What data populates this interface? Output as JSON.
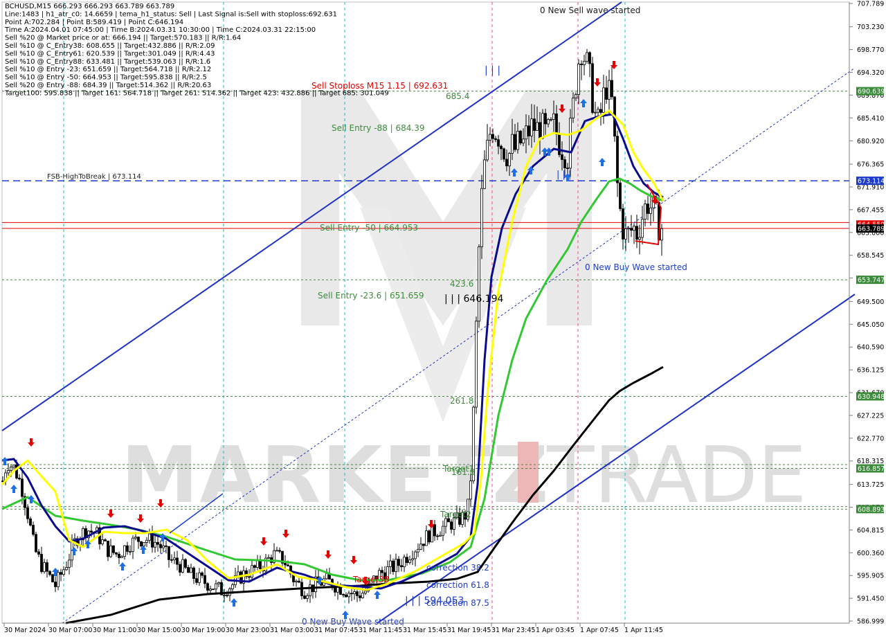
{
  "header": {
    "lines": [
      "BCHUSD,M15  666.293 666.293 663.789 663.789",
      "Line:1483 | h1_atr_c0: 14.6659 | tema_h1_status: Sell | Last Signal is:Sell with stoploss:692.631",
      "Point A:702.284 | Point B:589.419 | Point C:646.194",
      "Time A:2024.04.01 07:45:00 | Time B:2024.03.31 10:30:00 | Time C:2024.03.31 22:15:00",
      "Sell %20 @ Market price or at: 666.194 || Target:570.183 || R/R:1.64",
      "Sell %10 @ C_Entry38: 608.655 || Target:432.886 || R/R:2.09",
      "Sell %10 @ C_Entry61: 620.539 || Target:301.049 || R/R:4.43",
      "Sell %10 @ C_Entry88: 633.481 || Target:539.063 || R/R:1.6",
      "Sell %10 @ Entry -23: 651.659 || Target:564.718 || R/R:2.12",
      "Sell %10 @ Entry -50: 664.953 || Target:595.838 || R/R:2.5",
      "Sell %20 @ Entry -88: 684.39 || Target:514.362 || R/R:20.63",
      "Target100: 595.838 || Target 161: 564.718 || Target 261: 514.362 || Target 423: 432.886 || Target 685: 301.049"
    ]
  },
  "watermark": {
    "left": "MARKETZ",
    "right": "TRADE"
  },
  "chart_data": {
    "type": "candlestick",
    "symbol": "BCHUSD",
    "timeframe": "M15",
    "ylim": [
      586.999,
      707.789
    ],
    "y_ticks": [
      "707.789",
      "703.230",
      "698.770",
      "694.320",
      "689.870",
      "685.410",
      "680.920",
      "676.365",
      "671.910",
      "667.455",
      "663.000",
      "658.545",
      "654.090",
      "649.500",
      "645.050",
      "640.590",
      "636.125",
      "631.670",
      "627.225",
      "622.770",
      "618.315",
      "613.725",
      "609.270",
      "604.815",
      "600.360",
      "595.905",
      "591.450",
      "586.999"
    ],
    "x_ticks": [
      "30 Mar 2024",
      "30 Mar 07:00",
      "30 Mar 11:00",
      "30 Mar 15:00",
      "30 Mar 19:00",
      "30 Mar 23:00",
      "31 Mar 03:00",
      "31 Mar 07:45",
      "31 Mar 11:45",
      "31 Mar 15:45",
      "31 Mar 19:45",
      "31 Mar 23:45",
      "1 Apr 03:45",
      "1 Apr 07:45",
      "1 Apr 11:45"
    ],
    "last_price": {
      "value": 663.789,
      "label": "663.789",
      "color": "#000000"
    },
    "price_markers": [
      {
        "value": 690.639,
        "label": "690.639",
        "color": "#3c8c3c"
      },
      {
        "value": 673.114,
        "label": "673.114",
        "color": "#1e3cc8"
      },
      {
        "value": 664.559,
        "label": "664.559",
        "color": "#e60000"
      },
      {
        "value": 653.747,
        "label": "653.747",
        "color": "#3c8c3c"
      },
      {
        "value": 630.948,
        "label": "630.948",
        "color": "#3c8c3c"
      },
      {
        "value": 616.857,
        "label": "616.857",
        "color": "#3c8c3c"
      },
      {
        "value": 608.893,
        "label": "608.893",
        "color": "#3c8c3c"
      }
    ],
    "levels": [
      {
        "value": 690.639,
        "color": "#3c8c3c",
        "style": "dotted"
      },
      {
        "value": 673.114,
        "color": "#1e3cc8",
        "style": "dashed",
        "label": "FSB-HighToBreak | 673.114"
      },
      {
        "value": 664.953,
        "color": "#e60000",
        "style": "solid"
      },
      {
        "value": 663.789,
        "color": "#e60000",
        "style": "solid"
      },
      {
        "value": 653.747,
        "color": "#3c8c3c",
        "style": "dotted"
      },
      {
        "value": 630.948,
        "color": "#3c8c3c",
        "style": "dotted"
      },
      {
        "value": 617.6,
        "color": "#3c8c3c",
        "style": "dotted"
      },
      {
        "value": 616.857,
        "color": "#3c8c3c",
        "style": "dotted"
      },
      {
        "value": 609.4,
        "color": "#3c8c3c",
        "style": "dotted"
      },
      {
        "value": 608.893,
        "color": "#3c8c3c",
        "style": "dotted"
      }
    ],
    "annotations": [
      {
        "text": "0 New Sell wave started",
        "color": "#1e1e1e"
      },
      {
        "text": "Sell Stoploss M15 1.15 | 692.631",
        "color": "#e60000"
      },
      {
        "text": "685.4",
        "color": "#3c8c3c"
      },
      {
        "text": "Sell Entry -88 | 684.39",
        "color": "#3c8c3c"
      },
      {
        "text": "Sell Entry -50 | 664.953",
        "color": "#3c8c3c"
      },
      {
        "text": "0 New Buy Wave started",
        "color": "#1e3cc8"
      },
      {
        "text": "423.6",
        "color": "#3c8c3c"
      },
      {
        "text": "Sell Entry -23.6 | 651.659",
        "color": "#3c8c3c"
      },
      {
        "text": "| | | 646.194",
        "color": "#000000"
      },
      {
        "text": "261.8",
        "color": "#3c8c3c"
      },
      {
        "text": "Target1",
        "color": "#3c8c3c"
      },
      {
        "text": "161.8",
        "color": "#3c8c3c"
      },
      {
        "text": "Target2",
        "color": "#3c8c3c"
      },
      {
        "text": "correction 38.2",
        "color": "#1e3cc8"
      },
      {
        "text": "correction 61.8",
        "color": "#1e3cc8"
      },
      {
        "text": "correction 87.5",
        "color": "#1e3cc8"
      },
      {
        "text": "| | | 594.053",
        "color": "#1e3cc8"
      },
      {
        "text": "0 New Buy Wave started",
        "color": "#1e3cc8"
      },
      {
        "text": "| | |",
        "color": "#1e3cc8"
      },
      {
        "text": "| | |",
        "color": "#1e3cc8"
      },
      {
        "text": "Target38",
        "color": "#e60000"
      }
    ],
    "series": [
      {
        "name": "",
        "color": "#ffff00",
        "kind": "moving-average"
      },
      {
        "name": "",
        "color": "#0a0a8c",
        "kind": "moving-average"
      },
      {
        "name": "",
        "color": "#32c832",
        "kind": "moving-average"
      },
      {
        "name": "",
        "color": "#000000",
        "kind": "moving-average"
      }
    ],
    "candles_shape": [
      [
        0,
        612
      ],
      [
        10,
        618
      ],
      [
        20,
        617
      ],
      [
        30,
        614
      ],
      [
        40,
        608
      ],
      [
        50,
        601
      ],
      [
        60,
        598
      ],
      [
        70,
        596
      ],
      [
        80,
        594
      ],
      [
        95,
        598
      ],
      [
        110,
        603
      ],
      [
        125,
        605
      ],
      [
        140,
        604
      ],
      [
        155,
        601
      ],
      [
        170,
        600
      ],
      [
        185,
        602
      ],
      [
        200,
        603
      ],
      [
        215,
        603
      ],
      [
        230,
        602
      ],
      [
        245,
        599
      ],
      [
        260,
        598
      ],
      [
        275,
        596
      ],
      [
        290,
        595
      ],
      [
        305,
        594
      ],
      [
        320,
        593
      ],
      [
        335,
        594
      ],
      [
        350,
        596
      ],
      [
        365,
        597
      ],
      [
        380,
        598
      ],
      [
        395,
        600
      ],
      [
        410,
        599
      ],
      [
        425,
        595
      ],
      [
        440,
        593
      ],
      [
        455,
        594
      ],
      [
        470,
        595
      ],
      [
        485,
        594
      ],
      [
        500,
        593
      ],
      [
        515,
        592
      ],
      [
        530,
        593
      ],
      [
        545,
        596
      ],
      [
        560,
        597
      ],
      [
        575,
        598
      ],
      [
        590,
        600
      ],
      [
        605,
        602
      ],
      [
        620,
        604
      ],
      [
        635,
        605
      ],
      [
        650,
        606
      ],
      [
        665,
        607
      ],
      [
        675,
        608
      ],
      [
        680,
        615
      ],
      [
        684,
        628
      ],
      [
        688,
        645
      ],
      [
        692,
        660
      ],
      [
        696,
        670
      ],
      [
        700,
        676
      ],
      [
        705,
        680
      ],
      [
        710,
        684
      ],
      [
        715,
        683
      ],
      [
        720,
        682
      ],
      [
        725,
        680
      ],
      [
        730,
        679
      ],
      [
        735,
        678
      ],
      [
        740,
        680
      ],
      [
        745,
        679
      ],
      [
        750,
        681
      ],
      [
        755,
        680
      ],
      [
        760,
        682
      ],
      [
        765,
        683
      ],
      [
        770,
        684
      ],
      [
        775,
        683
      ],
      [
        780,
        684
      ],
      [
        785,
        683
      ],
      [
        790,
        682
      ],
      [
        795,
        683
      ],
      [
        800,
        684
      ],
      [
        805,
        682
      ],
      [
        810,
        680
      ],
      [
        815,
        679
      ],
      [
        820,
        678
      ],
      [
        825,
        684
      ],
      [
        830,
        690
      ],
      [
        835,
        696
      ],
      [
        840,
        699
      ],
      [
        845,
        697
      ],
      [
        850,
        695
      ],
      [
        855,
        690
      ],
      [
        860,
        686
      ],
      [
        865,
        684
      ],
      [
        870,
        688
      ],
      [
        875,
        692
      ],
      [
        880,
        690
      ],
      [
        885,
        688
      ],
      [
        890,
        675
      ],
      [
        895,
        668
      ],
      [
        900,
        664
      ],
      [
        905,
        662
      ],
      [
        910,
        663
      ],
      [
        915,
        664
      ],
      [
        920,
        663
      ],
      [
        925,
        665
      ],
      [
        930,
        667
      ],
      [
        935,
        669
      ],
      [
        940,
        668
      ],
      [
        945,
        667
      ],
      [
        950,
        665
      ],
      [
        955,
        664
      ],
      [
        958,
        663.8
      ]
    ]
  }
}
